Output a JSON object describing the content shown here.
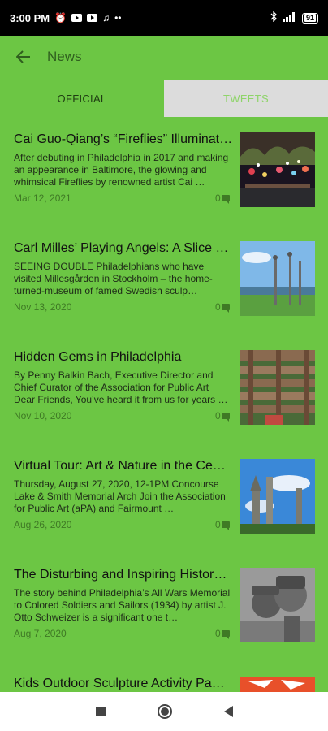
{
  "status_bar": {
    "time": "3:00 PM",
    "icons": [
      "alarm-icon",
      "youtube-icon",
      "youtube-icon",
      "music-note-icon",
      "more-dots-icon",
      "bluetooth-icon",
      "signal-icon",
      "battery-icon"
    ],
    "battery_level": "91"
  },
  "app_bar": {
    "title": "News"
  },
  "tabs": [
    {
      "label": "OFFICIAL",
      "selected": true
    },
    {
      "label": "TWEETS",
      "selected": false
    }
  ],
  "news": [
    {
      "title": "Cai Guo-Qiang’s “Fireflies” Illuminat…",
      "description": "After debuting in Philadelphia in 2017 and making an appearance in Baltimore, the glowing and whimsical Fireflies by renowned artist Cai …",
      "date": "Mar 12, 2021",
      "comments": "0"
    },
    {
      "title": "Carl Milles’ Playing Angels: A Slice …",
      "description": "SEEING DOUBLE Philadelphians who have visited Millesgården in Stockholm – the home-turned-museum of famed Swedish sculp…",
      "date": "Nov 13, 2020",
      "comments": "0"
    },
    {
      "title": "Hidden Gems in Philadelphia",
      "description": "By Penny Balkin Bach, Executive Director and Chief Curator of the Association for Public Art Dear Friends, You’ve heard it from us for years …",
      "date": "Nov 10, 2020",
      "comments": "0"
    },
    {
      "title": "Virtual Tour: Art & Nature in the Ce…",
      "description": "Thursday, August 27, 2020, 12-1PM  Concourse Lake & Smith Memorial Arch Join the Association for Public Art (aPA) and Fairmount …",
      "date": "Aug 26, 2020",
      "comments": "0"
    },
    {
      "title": "The Disturbing and Inspiring Histor…",
      "description": "The story behind Philadelphia’s All Wars Memorial to Colored Soldiers and Sailors (1934) by artist J. Otto Schweizer is a significant one t…",
      "date": "Aug 7, 2020",
      "comments": "0"
    },
    {
      "title": "Kids Outdoor Sculpture Activity Pa…",
      "description": "",
      "date": "",
      "comments": ""
    }
  ],
  "colors": {
    "background": "#6cc644",
    "tab_inactive": "#dcdcdc",
    "status_bar": "#000000",
    "nav_bar": "#ffffff"
  }
}
